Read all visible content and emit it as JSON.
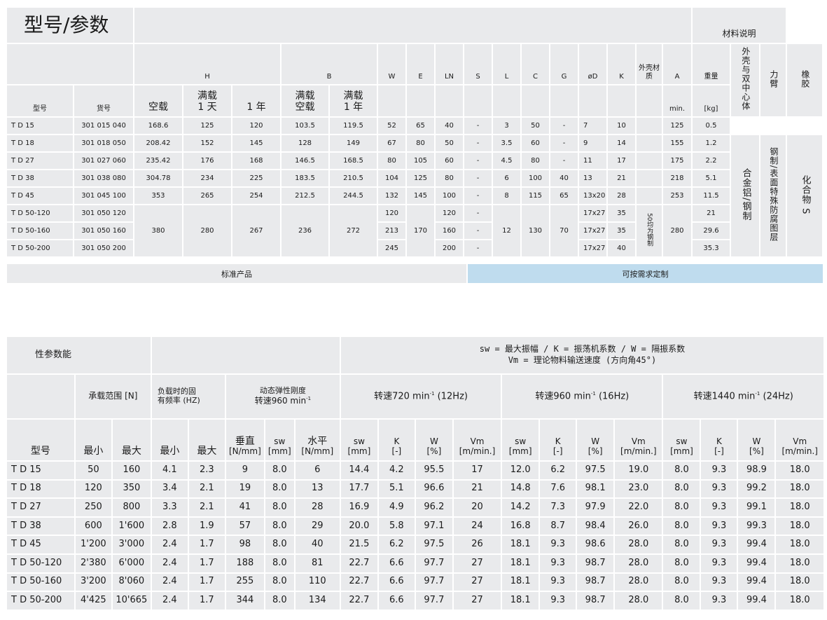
{
  "t1": {
    "title": "型号/参数",
    "material_title": "材料说明",
    "col_H": "H",
    "col_B": "B",
    "cols_single": [
      "W",
      "E",
      "LN",
      "S",
      "L",
      "C",
      "G",
      "øD",
      "K"
    ],
    "col_shell": "外壳材质",
    "col_A": "A",
    "col_weight": "重量",
    "mat_cols": [
      "外壳与双中心体",
      "力臂",
      "橡胶"
    ],
    "sub_model": "型号",
    "sub_item": "货号",
    "sub_H": [
      "空载",
      "满载\n1 天",
      "1 年"
    ],
    "sub_B": [
      "满载\n空载",
      "满载\n1 年"
    ],
    "sub_A": "min.",
    "sub_weight": "[kg]",
    "rows": [
      {
        "model": "T D 15",
        "item": "301 015 040",
        "H0": "168.6",
        "H1": "125",
        "H2": "120",
        "B1": "103.5",
        "B2": "119.5",
        "W": "52",
        "E": "65",
        "LN": "40",
        "S": "-",
        "L": "3",
        "C": "50",
        "G": "-",
        "D": "7",
        "K": "10",
        "A": "125",
        "wt": "0.5"
      },
      {
        "model": "T D 18",
        "item": "301 018 050",
        "H0": "208.42",
        "H1": "152",
        "H2": "145",
        "B1": "128",
        "B2": "149",
        "W": "67",
        "E": "80",
        "LN": "50",
        "S": "-",
        "L": "3.5",
        "C": "60",
        "G": "-",
        "D": "9",
        "K": "14",
        "A": "155",
        "wt": "1.2"
      },
      {
        "model": "T D 27",
        "item": "301 027 060",
        "H0": "235.42",
        "H1": "176",
        "H2": "168",
        "B1": "146.5",
        "B2": "168.5",
        "W": "80",
        "E": "105",
        "LN": "60",
        "S": "-",
        "L": "4.5",
        "C": "80",
        "G": "-",
        "D": "11",
        "K": "17",
        "A": "175",
        "wt": "2.2"
      },
      {
        "model": "T D 38",
        "item": "301 038 080",
        "H0": "304.78",
        "H1": "234",
        "H2": "225",
        "B1": "183.5",
        "B2": "210.5",
        "W": "104",
        "E": "125",
        "LN": "80",
        "S": "-",
        "L": "6",
        "C": "100",
        "G": "40",
        "D": "13",
        "K": "21",
        "A": "218",
        "wt": "5.1"
      },
      {
        "model": "T D 45",
        "item": "301 045 100",
        "H0": "353",
        "H1": "265",
        "H2": "254",
        "B1": "212.5",
        "B2": "244.5",
        "W": "132",
        "E": "145",
        "LN": "100",
        "S": "-",
        "L": "8",
        "C": "115",
        "G": "65",
        "D": "13x20",
        "K": "28",
        "A": "253",
        "wt": "11.5"
      }
    ],
    "td50": {
      "H0": "380",
      "H1": "280",
      "H2": "267",
      "B1": "236",
      "B2": "272",
      "E": "170",
      "L": "12",
      "C": "130",
      "G": "70",
      "A": "280",
      "shell": "50均为钢制",
      "rows": [
        {
          "model": "T D 50-120",
          "item": "301 050 120",
          "W": "120",
          "LN": "120",
          "S": "-",
          "D": "17x27",
          "K": "35",
          "wt": "21"
        },
        {
          "model": "T D 50-160",
          "item": "301 050 160",
          "W": "213",
          "LN": "160",
          "S": "-",
          "D": "17x27",
          "K": "35",
          "wt": "29.6"
        },
        {
          "model": "T D 50-200",
          "item": "301 050 200",
          "W": "245",
          "LN": "200",
          "S": "-",
          "D": "17x27",
          "K": "40",
          "wt": "35.3"
        }
      ]
    },
    "materials": [
      "合金铝/钢制",
      "钢制/表面特殊防腐图层",
      "化合物 S"
    ],
    "bar_standard": "标准产品",
    "bar_custom": "可按需求定制"
  },
  "t2": {
    "title": "性参数能",
    "legend_line1": "sw = 最大振幅 / K = 振荡机系数 / W = 隔振系数",
    "legend_line2": "Vm = 理论物料输送速度 (方向角45°)",
    "g_load": "承载范围 [N]",
    "g_freq": "负载时的固\n有频率 (HZ)",
    "g_stiff": "动态弹性刚度",
    "g_stiff2": "转速960 min",
    "g_speed": [
      {
        "pre": "转速720 min",
        "post": " (12Hz)"
      },
      {
        "pre": "转速960 min",
        "post": " (16Hz)"
      },
      {
        "pre": "转速1440 min",
        "post": " (24Hz)"
      }
    ],
    "sup": "-1",
    "h_model": "型号",
    "h_min": "最小",
    "h_max": "最大",
    "h_vert": [
      "垂直",
      "[N/mm]"
    ],
    "h_sw": [
      "sw",
      "[mm]"
    ],
    "h_horiz": [
      "水平",
      "[N/mm]"
    ],
    "h_K": [
      "K",
      "[-]"
    ],
    "h_W": [
      "W",
      "[%]"
    ],
    "h_Vm": [
      "Vm",
      "[m/min.]"
    ],
    "rows": [
      [
        "T D 15",
        "50",
        "160",
        "4.1",
        "2.3",
        "9",
        "8.0",
        "6",
        "14.4",
        "4.2",
        "95.5",
        "17",
        "12.0",
        "6.2",
        "97.5",
        "19.0",
        "8.0",
        "9.3",
        "98.9",
        "18.0"
      ],
      [
        "T D 18",
        "120",
        "350",
        "3.4",
        "2.1",
        "19",
        "8.0",
        "13",
        "17.7",
        "5.1",
        "96.6",
        "21",
        "14.8",
        "7.6",
        "98.1",
        "23.0",
        "8.0",
        "9.3",
        "99.2",
        "18.0"
      ],
      [
        "T D 27",
        "250",
        "800",
        "3.3",
        "2.1",
        "41",
        "8.0",
        "28",
        "16.9",
        "4.9",
        "96.2",
        "20",
        "14.2",
        "7.3",
        "97.9",
        "22.0",
        "8.0",
        "9.3",
        "99.1",
        "18.0"
      ],
      [
        "T D 38",
        "600",
        "1'600",
        "2.8",
        "1.9",
        "57",
        "8.0",
        "29",
        "20.0",
        "5.8",
        "97.1",
        "24",
        "16.8",
        "8.7",
        "98.4",
        "26.0",
        "8.0",
        "9.3",
        "99.3",
        "18.0"
      ],
      [
        "T D 45",
        "1'200",
        "3'000",
        "2.4",
        "1.7",
        "98",
        "8.0",
        "40",
        "21.5",
        "6.2",
        "97.5",
        "26",
        "18.1",
        "9.3",
        "98.6",
        "28.0",
        "8.0",
        "9.3",
        "99.4",
        "18.0"
      ],
      [
        "T D 50-120",
        "2'380",
        "6'000",
        "2.4",
        "1.7",
        "188",
        "8.0",
        "81",
        "22.7",
        "6.6",
        "97.7",
        "27",
        "18.1",
        "9.3",
        "98.7",
        "28.0",
        "8.0",
        "9.3",
        "99.4",
        "18.0"
      ],
      [
        "T D 50-160",
        "3'200",
        "8'060",
        "2.4",
        "1.7",
        "255",
        "8.0",
        "110",
        "22.7",
        "6.6",
        "97.7",
        "27",
        "18.1",
        "9.3",
        "98.7",
        "28.0",
        "8.0",
        "9.3",
        "99.4",
        "18.0"
      ],
      [
        "T D 50-200",
        "4'425",
        "10'665",
        "2.4",
        "1.7",
        "344",
        "8.0",
        "134",
        "22.7",
        "6.6",
        "97.7",
        "27",
        "18.1",
        "9.3",
        "98.7",
        "28.0",
        "8.0",
        "9.3",
        "99.4",
        "18.0"
      ]
    ]
  }
}
